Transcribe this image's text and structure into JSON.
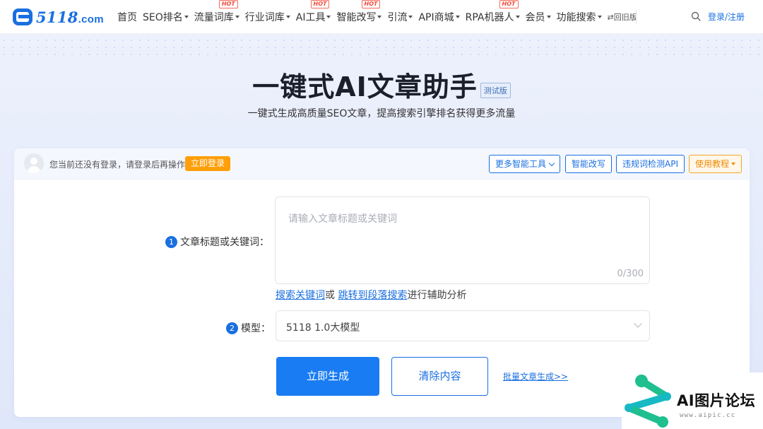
{
  "header": {
    "logo_text": "5118",
    "logo_domain": ".com",
    "nav": [
      {
        "label": "首页",
        "dropdown": false,
        "hot": false
      },
      {
        "label": "SEO排名",
        "dropdown": true,
        "hot": false
      },
      {
        "label": "流量词库",
        "dropdown": true,
        "hot": true
      },
      {
        "label": "行业词库",
        "dropdown": true,
        "hot": false
      },
      {
        "label": "AI工具",
        "dropdown": true,
        "hot": true
      },
      {
        "label": "智能改写",
        "dropdown": true,
        "hot": true
      },
      {
        "label": "引流",
        "dropdown": true,
        "hot": false
      },
      {
        "label": "API商城",
        "dropdown": true,
        "hot": false
      },
      {
        "label": "RPA机器人",
        "dropdown": true,
        "hot": true
      },
      {
        "label": "会员",
        "dropdown": true,
        "hot": false
      },
      {
        "label": "功能搜索",
        "dropdown": true,
        "hot": false
      }
    ],
    "hot_label": "HOT",
    "old_version": "⇄回旧版",
    "login_register": "登录/注册"
  },
  "hero": {
    "title": "一键式AI文章助手",
    "beta_badge": "测试版",
    "subtitle": "一键式生成高质量SEO文章，提高搜索引擎排名获得更多流量"
  },
  "card": {
    "login_notice": "您当前还没有登录，请登录后再操作",
    "login_now": "立即登录",
    "more_tools": "更多智能工具",
    "smart_rewrite": "智能改写",
    "violation_api": "违规词检测API",
    "tutorial": "使用教程",
    "step1_num": "1",
    "step1_label": "文章标题或关键词：",
    "input_placeholder": "请输入文章标题或关键词",
    "char_count": "0/300",
    "assist_link1": "搜索关键词",
    "assist_or": "或",
    "assist_link2": "跳转到段落搜索",
    "assist_tail": "进行辅助分析",
    "step2_num": "2",
    "step2_label": "模型：",
    "model_value": "5118 1.0大模型",
    "generate": "立即生成",
    "clear": "清除内容",
    "batch": "批量文章生成>>"
  },
  "watermark": {
    "title": "AI图片论坛",
    "url": "www.aipic.cc",
    "colors": [
      "#1fbf8f",
      "#16b9c4"
    ]
  },
  "colors": {
    "primary": "#1a7cf2",
    "accent_orange": "#fe9f0a",
    "hot_red": "#f04c3c"
  }
}
